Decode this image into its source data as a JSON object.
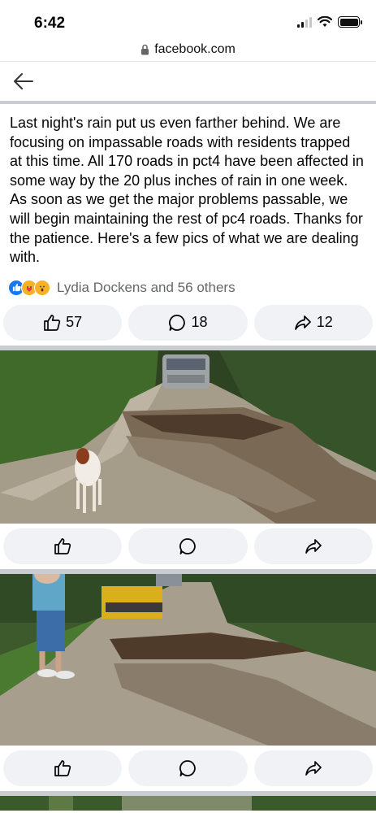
{
  "status_bar": {
    "time": "6:42"
  },
  "browser": {
    "url": "facebook.com"
  },
  "post": {
    "text": "Last night's rain put us even farther behind.  We are focusing on impassable roads with residents trapped at this time. All 170 roads in pct4 have been affected in some way by the 20 plus inches of rain in one week. As soon as we get the major problems passable, we will begin maintaining the rest of pc4 roads. Thanks for the patience.  Here's a few pics of what we are dealing with.",
    "reactions_text": "Lydia Dockens and 56 others",
    "likes": "57",
    "comments": "18",
    "shares": "12"
  },
  "icons": [
    "back-arrow-icon",
    "lock-icon",
    "like-icon",
    "comment-icon",
    "share-icon"
  ],
  "colors": {
    "like_blue": "#1877f2",
    "divider": "#c9ccd1",
    "pill_bg": "#f0f2f5",
    "secondary_text": "#65676b"
  }
}
